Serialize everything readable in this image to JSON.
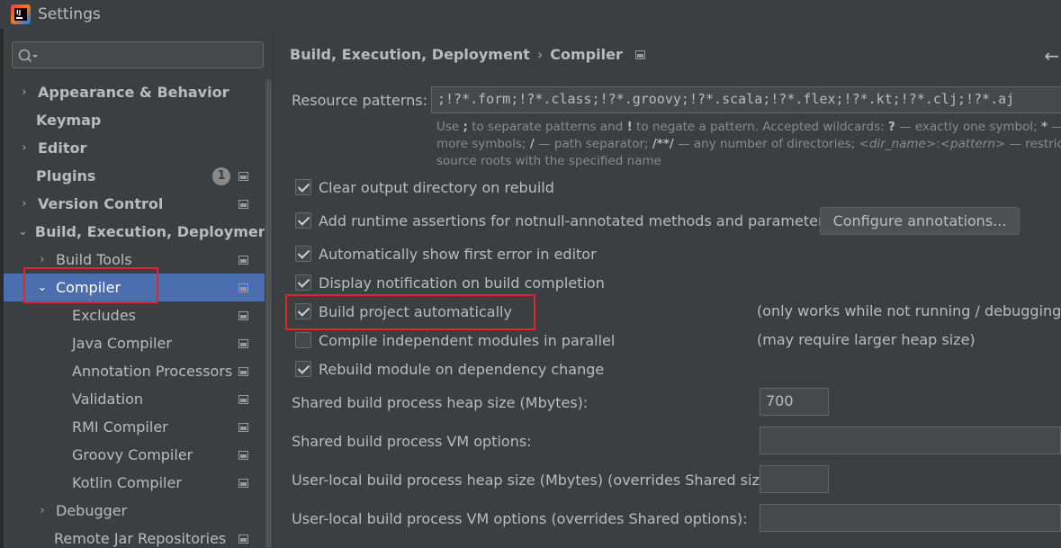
{
  "window": {
    "title": "Settings"
  },
  "search": {
    "placeholder": "",
    "value": ""
  },
  "sidebar": {
    "items": [
      {
        "label": "Appearance & Behavior",
        "arrow": "›",
        "bold": true
      },
      {
        "label": "Keymap",
        "bold": true
      },
      {
        "label": "Editor",
        "arrow": "›",
        "bold": true
      },
      {
        "label": "Plugins",
        "bold": true,
        "badge": "1"
      },
      {
        "label": "Version Control",
        "arrow": "›",
        "bold": true
      },
      {
        "label": "Build, Execution, Deployment",
        "arrow": "⌄",
        "bold": true
      },
      {
        "label": "Build Tools",
        "arrow": "›"
      },
      {
        "label": "Compiler",
        "arrow": "⌄",
        "selected": true
      },
      {
        "label": "Excludes"
      },
      {
        "label": "Java Compiler"
      },
      {
        "label": "Annotation Processors"
      },
      {
        "label": "Validation"
      },
      {
        "label": "RMI Compiler"
      },
      {
        "label": "Groovy Compiler"
      },
      {
        "label": "Kotlin Compiler"
      },
      {
        "label": "Debugger",
        "arrow": "›"
      },
      {
        "label": "Remote Jar Repositories"
      }
    ]
  },
  "breadcrumb": {
    "parent": "Build, Execution, Deployment",
    "separator": "›",
    "current": "Compiler"
  },
  "resource_patterns": {
    "label": "Resource patterns:",
    "value": ";!?*.form;!?*.class;!?*.groovy;!?*.scala;!?*.flex;!?*.kt;!?*.clj;!?*.aj",
    "hint": {
      "t1": "Use ",
      "b1": ";",
      "t2": " to separate patterns and ",
      "b2": "!",
      "t3": " to negate a pattern. Accepted wildcards: ",
      "b3": "?",
      "t4": " — exactly one symbol; ",
      "b4": "*",
      "t5": " — ze",
      "t6": "more symbols; ",
      "b5": "/",
      "t7": " — path separator; ",
      "b6": "/**/",
      "t8": " — any number of directories; ",
      "i1": "<dir_name>",
      "t9": ":",
      "i2": "<pattern>",
      "t10": " — restrict t",
      "line3": "source roots with the specified name"
    }
  },
  "options": [
    {
      "label": "Clear output directory on rebuild",
      "checked": true
    },
    {
      "label": "Add runtime assertions for notnull-annotated methods and parameters",
      "checked": true
    },
    {
      "label": "Automatically show first error in editor",
      "checked": true
    },
    {
      "label": "Display notification on build completion",
      "checked": true
    },
    {
      "label": "Build project automatically",
      "checked": true,
      "note": "(only works while not running / debugging)"
    },
    {
      "label": "Compile independent modules in parallel",
      "checked": false,
      "note": "(may require larger heap size)"
    },
    {
      "label": "Rebuild module on dependency change",
      "checked": true
    }
  ],
  "configure_button": "Configure annotations...",
  "fields": [
    {
      "label": "Shared build process heap size (Mbytes):",
      "value": "700"
    },
    {
      "label": "Shared build process VM options:",
      "value": ""
    },
    {
      "label": "User-local build process heap size (Mbytes) (overrides Shared size):",
      "value": ""
    },
    {
      "label": "User-local build process VM options (overrides Shared options):",
      "value": ""
    }
  ],
  "colors": {
    "background": "#3c3f41",
    "selection": "#4b6eaf",
    "highlight_box": "#e3242b",
    "text": "#bbbbbb"
  }
}
